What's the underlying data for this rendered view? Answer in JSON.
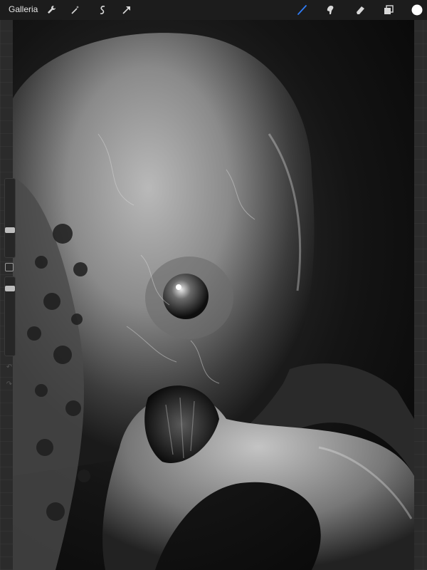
{
  "toolbar": {
    "gallery_label": "Galleria",
    "left_tools": [
      "wrench-icon",
      "magic-wand-icon",
      "selection-icon",
      "transform-arrow-icon"
    ],
    "right_tools": [
      "brush-icon",
      "smudge-icon",
      "eraser-icon",
      "layers-icon",
      "color-swatch"
    ],
    "active_tool": "brush",
    "accent_color": "#2f7cf6",
    "current_color": "#ffffff"
  },
  "sidebar": {
    "brush_size_level": 0.3,
    "opacity_level": 0.1,
    "icons": [
      "modify-button",
      "undo-icon",
      "redo-icon"
    ]
  },
  "canvas": {
    "style": "grayscale digital painting"
  }
}
